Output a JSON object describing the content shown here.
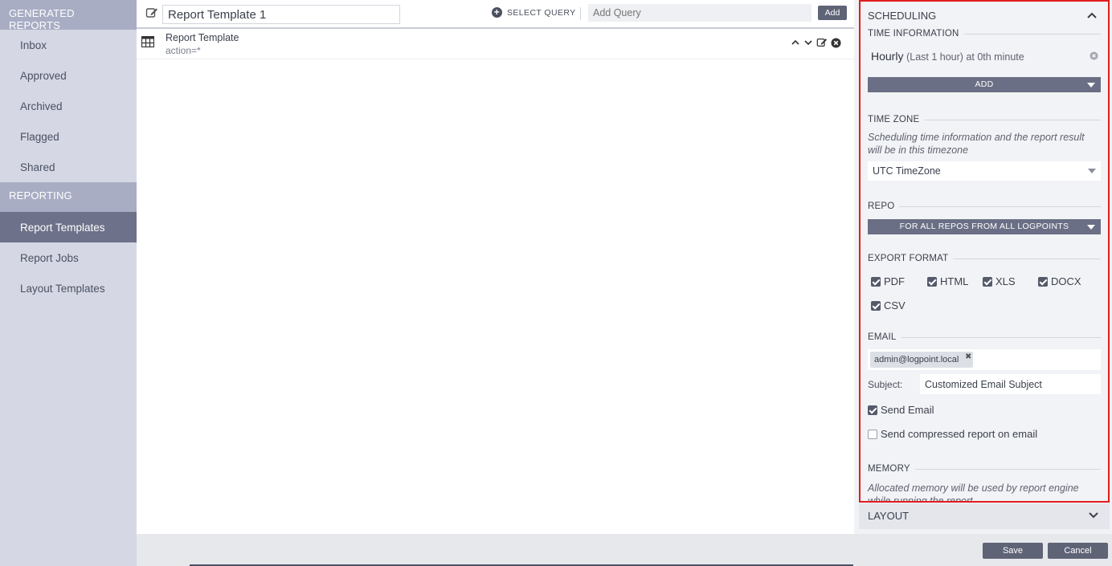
{
  "sidebar": {
    "section1": "GENERATED REPORTS",
    "items1": [
      "Inbox",
      "Approved",
      "Archived",
      "Flagged",
      "Shared"
    ],
    "section2": "REPORTING",
    "items2": [
      "Report Templates",
      "Report Jobs",
      "Layout Templates"
    ],
    "active": "Report Templates"
  },
  "toolbar": {
    "title_value": "Report Template 1",
    "select_query_label": "SELECT QUERY",
    "add_query_placeholder": "Add Query",
    "add_label": "Add"
  },
  "query": {
    "name": "Report Template",
    "query_text": "action=*"
  },
  "scheduling": {
    "header": "SCHEDULING",
    "time_info_title": "TIME INFORMATION",
    "time_entry_main": "Hourly",
    "time_entry_detail": "(Last 1 hour) at 0th minute",
    "add_label": "ADD",
    "timezone_title": "TIME ZONE",
    "timezone_note": "Scheduling time information and the report result will be in this timezone",
    "timezone_value": "UTC TimeZone",
    "repo_title": "REPO",
    "repo_value": "FOR ALL REPOS FROM ALL LOGPOINTS",
    "export_title": "EXPORT FORMAT",
    "formats": [
      {
        "label": "PDF",
        "checked": true
      },
      {
        "label": "HTML",
        "checked": true
      },
      {
        "label": "XLS",
        "checked": true
      },
      {
        "label": "DOCX",
        "checked": true
      },
      {
        "label": "CSV",
        "checked": true
      }
    ],
    "email_title": "EMAIL",
    "email_tag": "admin@logpoint.local",
    "subject_label": "Subject:",
    "subject_value": "Customized Email Subject",
    "send_email_label": "Send Email",
    "send_email_checked": true,
    "send_compressed_label": "Send compressed report on email",
    "send_compressed_checked": false,
    "memory_title": "MEMORY",
    "memory_note": "Allocated memory will be used by report engine while running the report"
  },
  "layout": {
    "header": "LAYOUT"
  },
  "footer": {
    "save_label": "Save",
    "cancel_label": "Cancel"
  },
  "colors": {
    "sidebar_bg": "#d5d8e4",
    "sidebar_active": "#6d7189",
    "highlight_border": "#e11d1d",
    "button_dark": "#5f6376"
  }
}
